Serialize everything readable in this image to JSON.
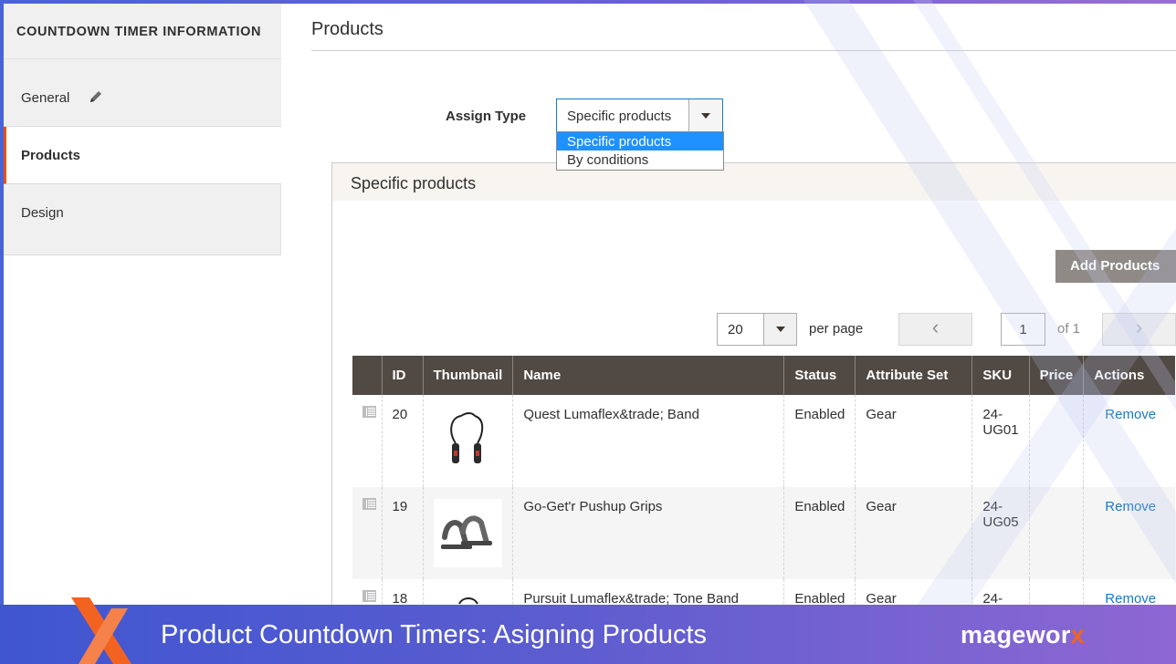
{
  "sidebar": {
    "title": "COUNTDOWN TIMER INFORMATION",
    "items": [
      {
        "label": "General",
        "icon": "pencil-icon"
      },
      {
        "label": "Products"
      },
      {
        "label": "Design"
      }
    ]
  },
  "main": {
    "title": "Products",
    "assign_type": {
      "label": "Assign Type",
      "value": "Specific products",
      "options": [
        "Specific products",
        "By conditions"
      ]
    },
    "fieldset": {
      "title": "Specific products",
      "add_button": "Add Products",
      "pager": {
        "per_page_value": "20",
        "per_page_label": "per page",
        "prev": "‹",
        "page": "1",
        "of_pages": "of 1",
        "next": "›"
      },
      "grid": {
        "columns": [
          "ID",
          "Thumbnail",
          "Name",
          "Status",
          "Attribute Set",
          "SKU",
          "Price",
          "Actions"
        ],
        "rows": [
          {
            "id": "20",
            "name": "Quest Lumaflex&trade; Band",
            "status": "Enabled",
            "attribute_set": "Gear",
            "sku": "24-\nUG01",
            "price": "",
            "action": "Remove"
          },
          {
            "id": "19",
            "name": "Go-Get'r Pushup Grips",
            "status": "Enabled",
            "attribute_set": "Gear",
            "sku": "24-\nUG05",
            "price": "",
            "action": "Remove"
          },
          {
            "id": "18",
            "name": "Pursuit Lumaflex&trade; Tone Band",
            "status": "Enabled",
            "attribute_set": "Gear",
            "sku": "24-",
            "price": "",
            "action": "Remove"
          }
        ]
      }
    }
  },
  "banner": {
    "title": "Product Countdown Timers: Asigning Products",
    "brand_main": "magewor",
    "brand_accent": "x"
  },
  "colors": {
    "accent_orange": "#eb5202",
    "link_blue": "#1979c3",
    "grid_header": "#514943",
    "button_gray": "#8f8a85",
    "dropdown_selected": "#1e90ff",
    "banner_blue": "#3f56d1"
  }
}
